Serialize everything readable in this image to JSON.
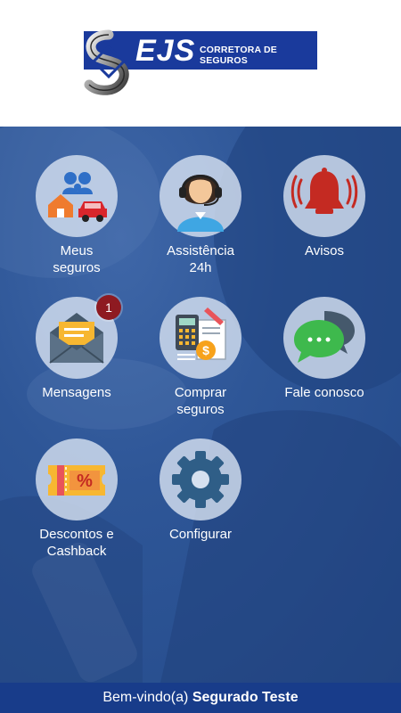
{
  "header": {
    "logo_text": "EJS",
    "logo_subtitle": "CORRETORA DE SEGUROS"
  },
  "menu": [
    {
      "id": "meus-seguros",
      "label": "Meus\nseguros",
      "icon": "family-home-car-icon"
    },
    {
      "id": "assistencia",
      "label": "Assistência\n24h",
      "icon": "headset-agent-icon"
    },
    {
      "id": "avisos",
      "label": "Avisos",
      "icon": "alarm-bell-icon"
    },
    {
      "id": "mensagens",
      "label": "Mensagens",
      "icon": "envelope-icon",
      "badge": "1"
    },
    {
      "id": "comprar-seguros",
      "label": "Comprar\nseguros",
      "icon": "calculator-document-icon"
    },
    {
      "id": "fale-conosco",
      "label": "Fale conosco",
      "icon": "chat-bubbles-icon"
    },
    {
      "id": "descontos",
      "label": "Descontos e\nCashback",
      "icon": "discount-coupon-icon"
    },
    {
      "id": "configurar",
      "label": "Configurar",
      "icon": "gear-icon"
    }
  ],
  "footer": {
    "welcome_prefix": "Bem-vindo(a)",
    "user_name": "Segurado Teste"
  },
  "colors": {
    "brand_blue": "#1a3a9c",
    "footer_bg": "#183c8a",
    "badge_red": "#8e1a21"
  }
}
